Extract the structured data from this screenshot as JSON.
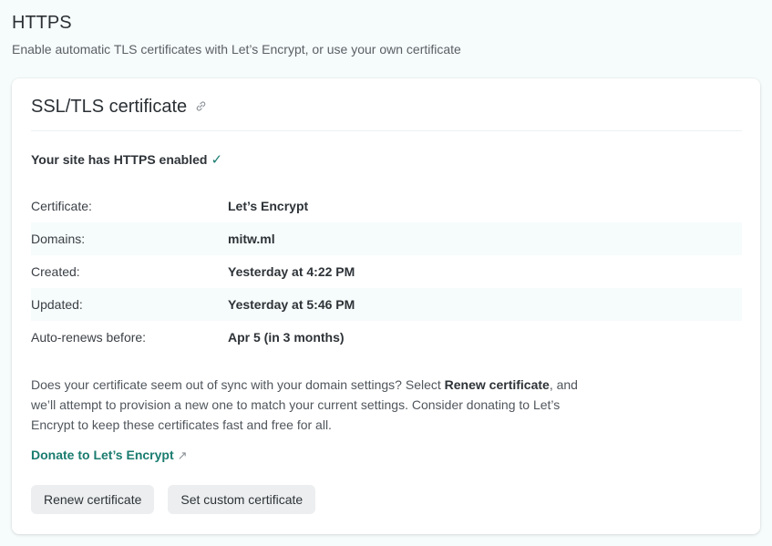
{
  "section": {
    "title": "HTTPS",
    "subtitle": "Enable automatic TLS certificates with Let’s Encrypt, or use your own certificate"
  },
  "card": {
    "title": "SSL/TLS certificate",
    "title_icon": "link-icon",
    "status_text": "Your site has HTTPS enabled",
    "status_icon": "✓",
    "details": [
      {
        "label": "Certificate:",
        "value": "Let’s Encrypt"
      },
      {
        "label": "Domains:",
        "value": "mitw.ml"
      },
      {
        "label": "Created:",
        "value": "Yesterday at 4:22 PM"
      },
      {
        "label": "Updated:",
        "value": "Yesterday at 5:46 PM"
      },
      {
        "label": "Auto-renews before:",
        "value": "Apr 5 (in 3 months)"
      }
    ],
    "description": {
      "part1": "Does your certificate seem out of sync with your domain settings? Select ",
      "bold": "Renew certificate",
      "part2": ", and we’ll attempt to provision a new one to match your current settings. Consider donating to Let’s Encrypt to keep these certificates fast and free for all."
    },
    "donate_link": "Donate to Let’s Encrypt",
    "external_icon": "↗",
    "buttons": {
      "renew": "Renew certificate",
      "custom": "Set custom certificate"
    }
  },
  "colors": {
    "accent": "#1a7c6f",
    "page_background": "#f6fbfb",
    "button_background": "#eceeef"
  }
}
